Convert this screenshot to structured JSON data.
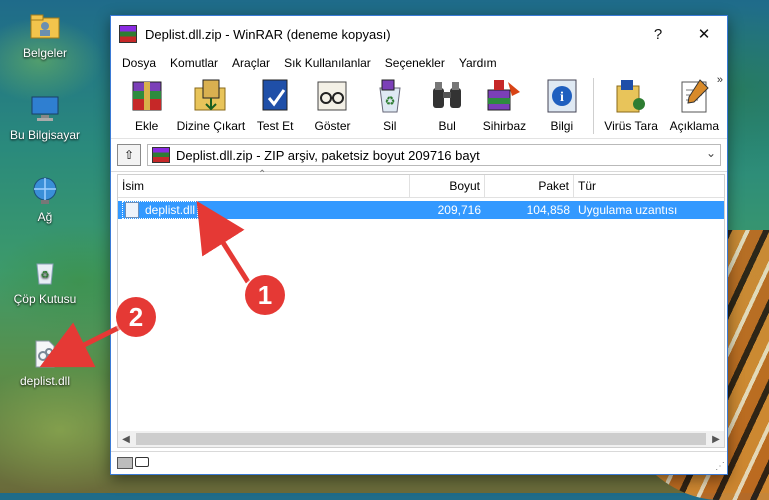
{
  "desktop": {
    "icons": [
      {
        "label": "Belgeler",
        "icon": "folder-user-icon"
      },
      {
        "label": "Bu Bilgisayar",
        "icon": "computer-icon"
      },
      {
        "label": "Ağ",
        "icon": "network-globe-icon"
      },
      {
        "label": "Çöp Kutusu",
        "icon": "recycle-bin-icon"
      },
      {
        "label": "deplist.dll",
        "icon": "dll-file-icon"
      }
    ]
  },
  "window": {
    "title": "Deplist.dll.zip - WinRAR (deneme kopyası)",
    "buttons": {
      "help": "?",
      "close": "✕"
    }
  },
  "menu": [
    "Dosya",
    "Komutlar",
    "Araçlar",
    "Sık Kullanılanlar",
    "Seçenekler",
    "Yardım"
  ],
  "toolbar": {
    "items": [
      {
        "label": "Ekle",
        "icon": "add-archive-icon"
      },
      {
        "label": "Dizine Çıkart",
        "icon": "extract-folder-icon"
      },
      {
        "label": "Test Et",
        "icon": "test-archive-icon"
      },
      {
        "label": "Göster",
        "icon": "view-glasses-icon"
      },
      {
        "label": "Sil",
        "icon": "delete-recycle-icon"
      },
      {
        "label": "Bul",
        "icon": "find-binoculars-icon"
      },
      {
        "label": "Sihirbaz",
        "icon": "wizard-icon"
      },
      {
        "label": "Bilgi",
        "icon": "info-icon"
      },
      {
        "label": "Virüs Tara",
        "icon": "virus-scan-icon"
      },
      {
        "label": "Açıklama",
        "icon": "comment-icon"
      }
    ],
    "more": "»"
  },
  "addressbar": {
    "up": "⇧",
    "text": "Deplist.dll.zip - ZIP arşiv, paketsiz boyut 209716 bayt",
    "dropdown": "⌄"
  },
  "filelist": {
    "columns": {
      "name": "İsim",
      "size": "Boyut",
      "packed": "Paket",
      "type": "Tür"
    },
    "rows": [
      {
        "name": "deplist.dll",
        "size": "209,716",
        "packed": "104,858",
        "type": "Uygulama uzantısı"
      }
    ]
  },
  "annotations": {
    "badge1": "1",
    "badge2": "2",
    "color": "#e53935"
  },
  "colors": {
    "selection": "#3399ff",
    "window_border": "#3a7ad6"
  }
}
